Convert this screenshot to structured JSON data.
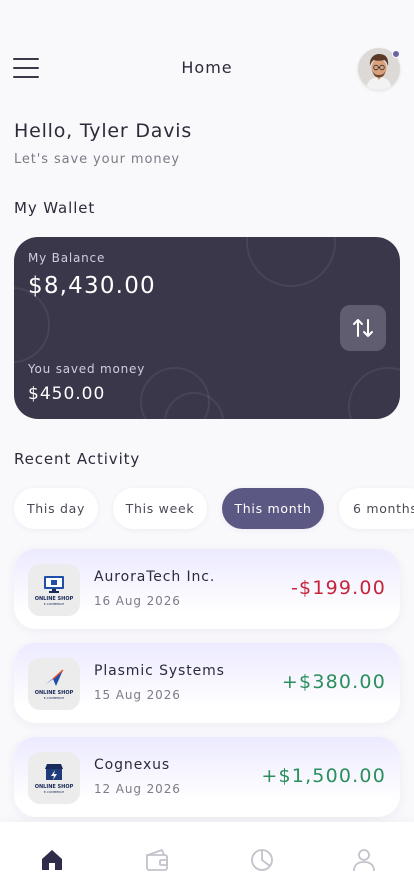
{
  "header": {
    "title": "Home",
    "menu_icon": "hamburger-menu-icon",
    "avatar_icon": "user-avatar"
  },
  "greeting": {
    "hello": "Hello, Tyler Davis",
    "subtitle": "Let's save your money"
  },
  "wallet": {
    "section_title": "My Wallet",
    "balance_label": "My Balance",
    "balance_value": "$8,430.00",
    "saved_label": "You saved money",
    "saved_value": "$450.00",
    "transfer_icon": "transfer-arrows-icon",
    "card_color": "#393749"
  },
  "activity": {
    "section_title": "Recent Activity",
    "tabs": [
      "This day",
      "This week",
      "This month",
      "6 months"
    ],
    "active_tab": "This month",
    "items": [
      {
        "company": "AuroraTech Inc.",
        "date": "16 Aug 2026",
        "amount": "-$199.00",
        "type": "negative",
        "logo_text": "ONLINE SHOP",
        "logo_sub": "E-COMMERCE"
      },
      {
        "company": "Plasmic Systems",
        "date": "15 Aug 2026",
        "amount": "+$380.00",
        "type": "positive",
        "logo_text": "ONLINE SHOP",
        "logo_sub": "E-COMMERCE"
      },
      {
        "company": "Cognexus",
        "date": "12 Aug 2026",
        "amount": "+$1,500.00",
        "type": "positive",
        "logo_text": "ONLINE SHOP",
        "logo_sub": "E-COMMERCE"
      }
    ]
  },
  "bottom_nav": {
    "items": [
      "home-icon",
      "wallet-icon",
      "pie-chart-icon",
      "profile-icon"
    ],
    "active": "home-icon"
  },
  "colors": {
    "accent": "#5b5984",
    "negative": "#c7243a",
    "positive": "#2b8f5c",
    "background": "#f9f8fb"
  }
}
